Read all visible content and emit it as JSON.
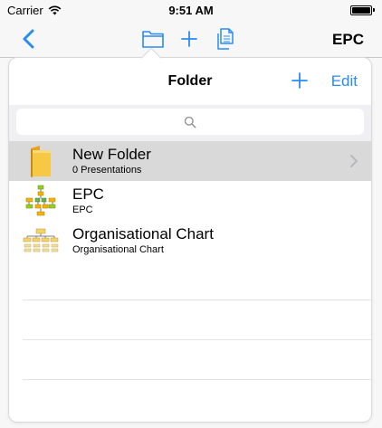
{
  "status_bar": {
    "carrier": "Carrier",
    "time": "9:51 AM"
  },
  "nav_bar": {
    "title": "EPC",
    "accent": "#2a8bf2"
  },
  "popover": {
    "title": "Folder",
    "edit_label": "Edit",
    "items": [
      {
        "title": "New Folder",
        "subtitle": "0 Presentations",
        "icon": "folder-icon",
        "selected": true
      },
      {
        "title": "EPC",
        "subtitle": "EPC",
        "icon": "epc-diagram-icon",
        "selected": false
      },
      {
        "title": "Organisational Chart",
        "subtitle": "Organisational Chart",
        "icon": "org-chart-icon",
        "selected": false
      }
    ]
  }
}
